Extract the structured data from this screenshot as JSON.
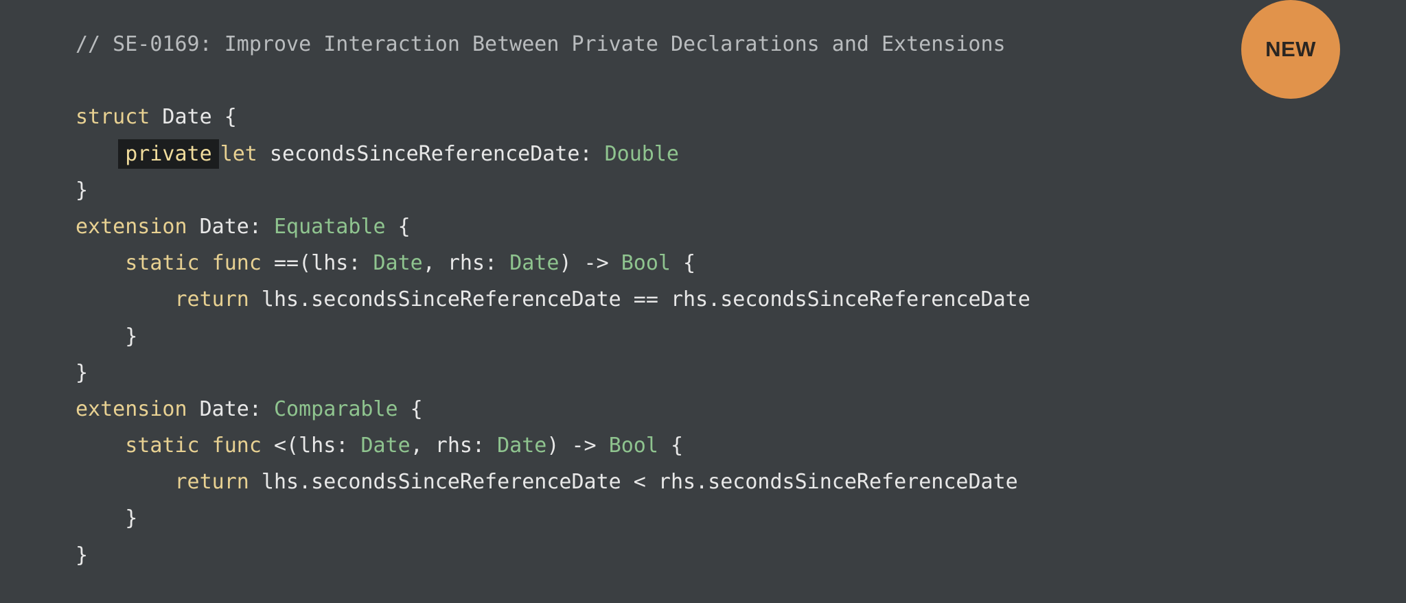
{
  "badge": {
    "label": "NEW"
  },
  "code": {
    "comment": "// SE-0169: Improve Interaction Between Private Declarations and Extensions",
    "lines": [
      [
        {
          "t": "kw",
          "v": "struct"
        },
        {
          "t": "pl",
          "v": " Date {"
        }
      ],
      [
        {
          "t": "pl",
          "v": "    "
        },
        {
          "t": "hl",
          "v": "private"
        },
        {
          "t": "kw",
          "v": "let"
        },
        {
          "t": "pl",
          "v": " secondsSinceReferenceDate: "
        },
        {
          "t": "ty",
          "v": "Double"
        }
      ],
      [
        {
          "t": "pl",
          "v": "}"
        }
      ],
      [
        {
          "t": "kw",
          "v": "extension"
        },
        {
          "t": "pl",
          "v": " Date: "
        },
        {
          "t": "ty",
          "v": "Equatable"
        },
        {
          "t": "pl",
          "v": " {"
        }
      ],
      [
        {
          "t": "pl",
          "v": "    "
        },
        {
          "t": "kw",
          "v": "static func"
        },
        {
          "t": "pl",
          "v": " ==(lhs: "
        },
        {
          "t": "ty",
          "v": "Date"
        },
        {
          "t": "pl",
          "v": ", rhs: "
        },
        {
          "t": "ty",
          "v": "Date"
        },
        {
          "t": "pl",
          "v": ") -> "
        },
        {
          "t": "ty",
          "v": "Bool"
        },
        {
          "t": "pl",
          "v": " {"
        }
      ],
      [
        {
          "t": "pl",
          "v": "        "
        },
        {
          "t": "kw",
          "v": "return"
        },
        {
          "t": "pl",
          "v": " lhs.secondsSinceReferenceDate == rhs.secondsSinceReferenceDate"
        }
      ],
      [
        {
          "t": "pl",
          "v": "    }"
        }
      ],
      [
        {
          "t": "pl",
          "v": "}"
        }
      ],
      [
        {
          "t": "kw",
          "v": "extension"
        },
        {
          "t": "pl",
          "v": " Date: "
        },
        {
          "t": "ty",
          "v": "Comparable"
        },
        {
          "t": "pl",
          "v": " {"
        }
      ],
      [
        {
          "t": "pl",
          "v": "    "
        },
        {
          "t": "kw",
          "v": "static func"
        },
        {
          "t": "pl",
          "v": " <(lhs: "
        },
        {
          "t": "ty",
          "v": "Date"
        },
        {
          "t": "pl",
          "v": ", rhs: "
        },
        {
          "t": "ty",
          "v": "Date"
        },
        {
          "t": "pl",
          "v": ") -> "
        },
        {
          "t": "ty",
          "v": "Bool"
        },
        {
          "t": "pl",
          "v": " {"
        }
      ],
      [
        {
          "t": "pl",
          "v": "        "
        },
        {
          "t": "kw",
          "v": "return"
        },
        {
          "t": "pl",
          "v": " lhs.secondsSinceReferenceDate < rhs.secondsSinceReferenceDate"
        }
      ],
      [
        {
          "t": "pl",
          "v": "    }"
        }
      ],
      [
        {
          "t": "pl",
          "v": "}"
        }
      ]
    ]
  },
  "colors": {
    "background": "#3b3f42",
    "keyword": "#e8d192",
    "type": "#8fc48f",
    "plain": "#e8e8e8",
    "comment": "#b9bcbe",
    "badge": "#e1934b"
  }
}
